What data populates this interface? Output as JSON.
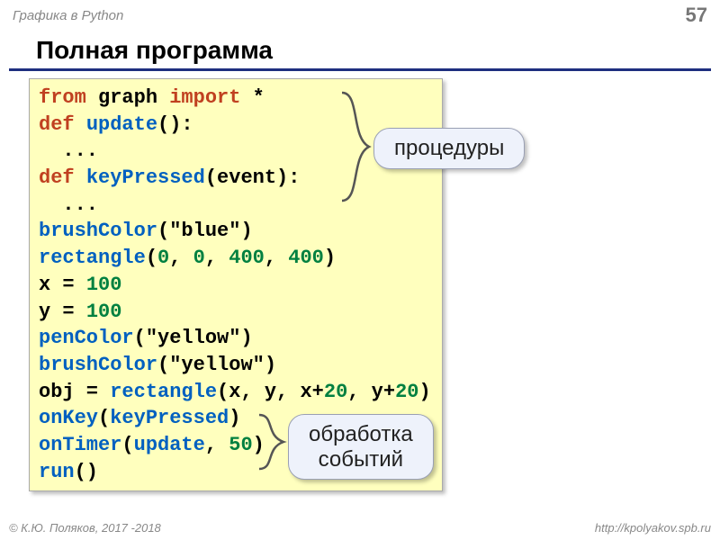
{
  "header": {
    "subject": "Графика в Python",
    "page": "57"
  },
  "title": "Полная программа",
  "code": {
    "l1a": "from",
    "l1b": " graph ",
    "l1c": "import",
    "l1d": " *",
    "l2a": "def",
    "l2b": " ",
    "l2c": "update",
    "l2d": "():",
    "l3": "  ...",
    "l4a": "def",
    "l4b": " ",
    "l4c": "keyPressed",
    "l4d": "(event):",
    "l5": "  ...",
    "l6a": "brushColor",
    "l6b": "(\"blue\")",
    "l7a": "rectangle",
    "l7b": "(",
    "l7c": "0",
    "l7d": ", ",
    "l7e": "0",
    "l7f": ", ",
    "l7g": "400",
    "l7h": ", ",
    "l7i": "400",
    "l7j": ")",
    "l8a": "x = ",
    "l8b": "100",
    "l9a": "y = ",
    "l9b": "100",
    "l10a": "penColor",
    "l10b": "(\"yellow\")",
    "l11a": "brushColor",
    "l11b": "(\"yellow\")",
    "l12a": "obj = ",
    "l12b": "rectangle",
    "l12c": "(x, y, x+",
    "l12d": "20",
    "l12e": ", y+",
    "l12f": "20",
    "l12g": ")",
    "l13a": "onKey",
    "l13b": "(",
    "l13c": "keyPressed",
    "l13d": ")",
    "l14a": "onTimer",
    "l14b": "(",
    "l14c": "update",
    "l14d": ", ",
    "l14e": "50",
    "l14f": ")",
    "l15a": "run",
    "l15b": "()"
  },
  "callouts": {
    "procedures": "процедуры",
    "events_l1": "обработка",
    "events_l2": "событий"
  },
  "footer": {
    "left": "© К.Ю. Поляков, 2017 -2018",
    "right": "http://kpolyakov.spb.ru"
  }
}
